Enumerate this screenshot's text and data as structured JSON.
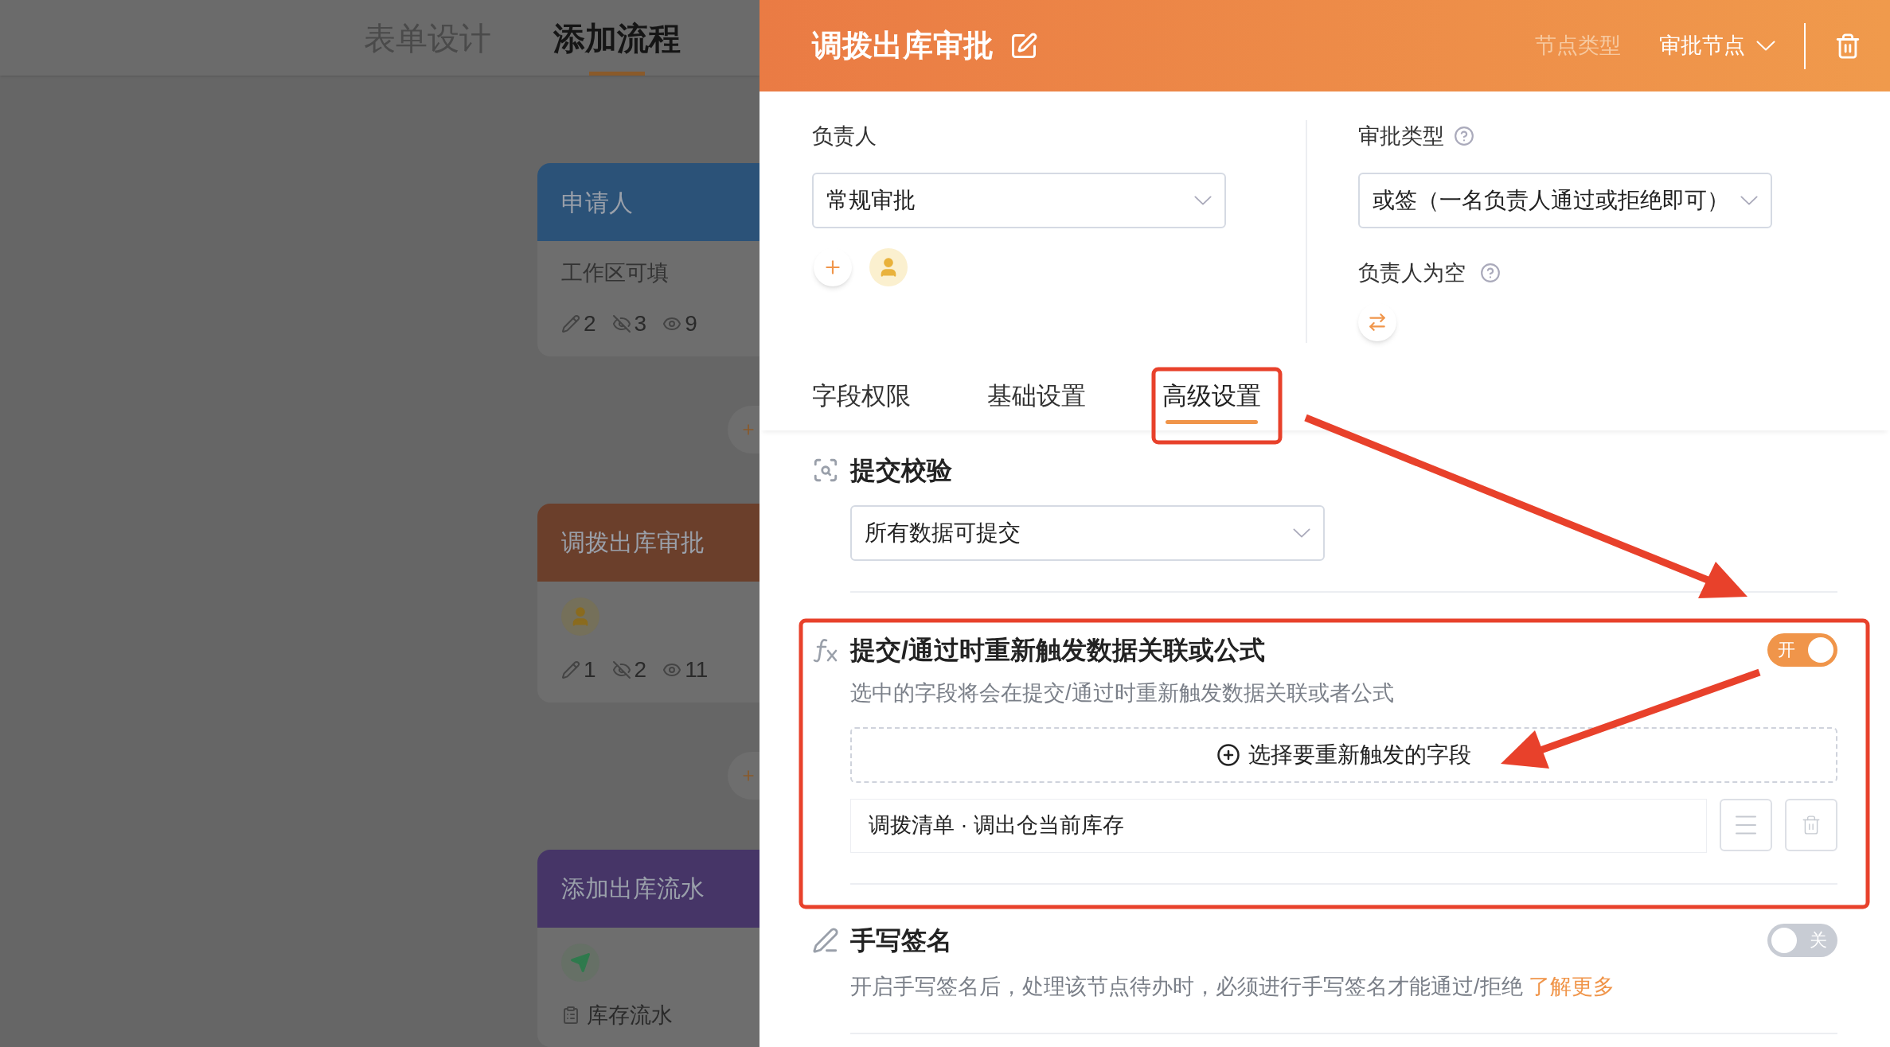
{
  "top_tabs": [
    {
      "label": "表单设计",
      "selected": false
    },
    {
      "label": "添加流程",
      "selected": true
    }
  ],
  "flow_nodes": [
    {
      "kind": "stats",
      "title": "申请人",
      "color": "#2b5278",
      "subtitle": "工作区可填",
      "stats": [
        "2",
        "3",
        "9"
      ]
    },
    {
      "kind": "avatar",
      "title": "调拨出库审批",
      "color": "#6b3f2b",
      "stats": [
        "1",
        "2",
        "11"
      ]
    },
    {
      "kind": "send",
      "title": "添加出库流水",
      "color": "#463567",
      "item": "库存流水"
    }
  ],
  "panel": {
    "title": "调拨出库审批",
    "node_type_label": "节点类型",
    "node_type": "审批节点",
    "assignee": {
      "label": "负责人",
      "value": "常规审批"
    },
    "approval_type": {
      "label": "审批类型",
      "value": "或签（一名负责人通过或拒绝即可）"
    },
    "empty_assignee": {
      "label": "负责人为空"
    },
    "tabs": [
      {
        "label": "字段权限",
        "selected": false
      },
      {
        "label": "基础设置",
        "selected": false
      },
      {
        "label": "高级设置",
        "selected": true
      }
    ],
    "submit_check": {
      "title": "提交校验",
      "value": "所有数据可提交"
    },
    "retrigger": {
      "title": "提交/通过时重新触发数据关联或公式",
      "on": true,
      "toggle_label": "开",
      "description": "选中的字段将会在提交/通过时重新触发数据关联或者公式",
      "add_button": "选择要重新触发的字段",
      "fields": [
        "调拨清单 · 调出仓当前库存"
      ]
    },
    "signature": {
      "title": "手写签名",
      "on": false,
      "toggle_label": "关",
      "description": "开启手写签名后，处理该节点待办时，必须进行手写签名才能通过/拒绝",
      "link": "了解更多"
    }
  }
}
